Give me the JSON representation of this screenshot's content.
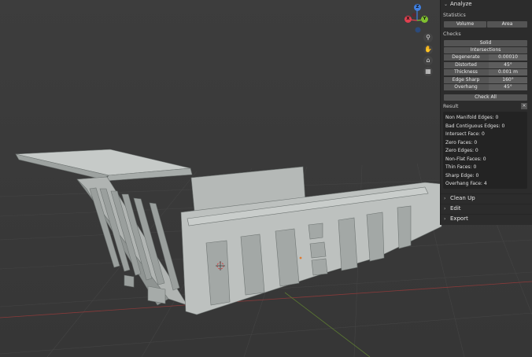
{
  "panel": {
    "analyze_header": "Analyze",
    "statistics_label": "Statistics",
    "volume_btn": "Volume",
    "area_btn": "Area",
    "checks_label": "Checks",
    "solid_btn": "Solid",
    "intersections_btn": "Intersections",
    "fields": [
      {
        "label": "Degenerate",
        "value": "0.00010"
      },
      {
        "label": "Distorted",
        "value": "45°"
      },
      {
        "label": "Thickness",
        "value": "0.001 m"
      },
      {
        "label": "Edge Sharp",
        "value": "160°"
      },
      {
        "label": "Overhang",
        "value": "45°"
      }
    ],
    "check_all_btn": "Check All",
    "result_label": "Result",
    "close_glyph": "×",
    "results": [
      "Non Manifold Edges: 0",
      "Bad Contiguous Edges: 0",
      "Intersect Face: 0",
      "Zero Faces: 0",
      "Zero Edges: 0",
      "Non-Flat Faces: 0",
      "Thin Faces: 0",
      "Sharp Edge: 0",
      "Overhang Face: 4"
    ],
    "collapsed": [
      "Clean Up",
      "Edit",
      "Export"
    ]
  },
  "gizmo": {
    "z": "Z",
    "x": "X",
    "y": "Y"
  },
  "colors": {
    "x": "#e0404f",
    "y": "#7fbf2f",
    "z": "#3f7fe0"
  }
}
